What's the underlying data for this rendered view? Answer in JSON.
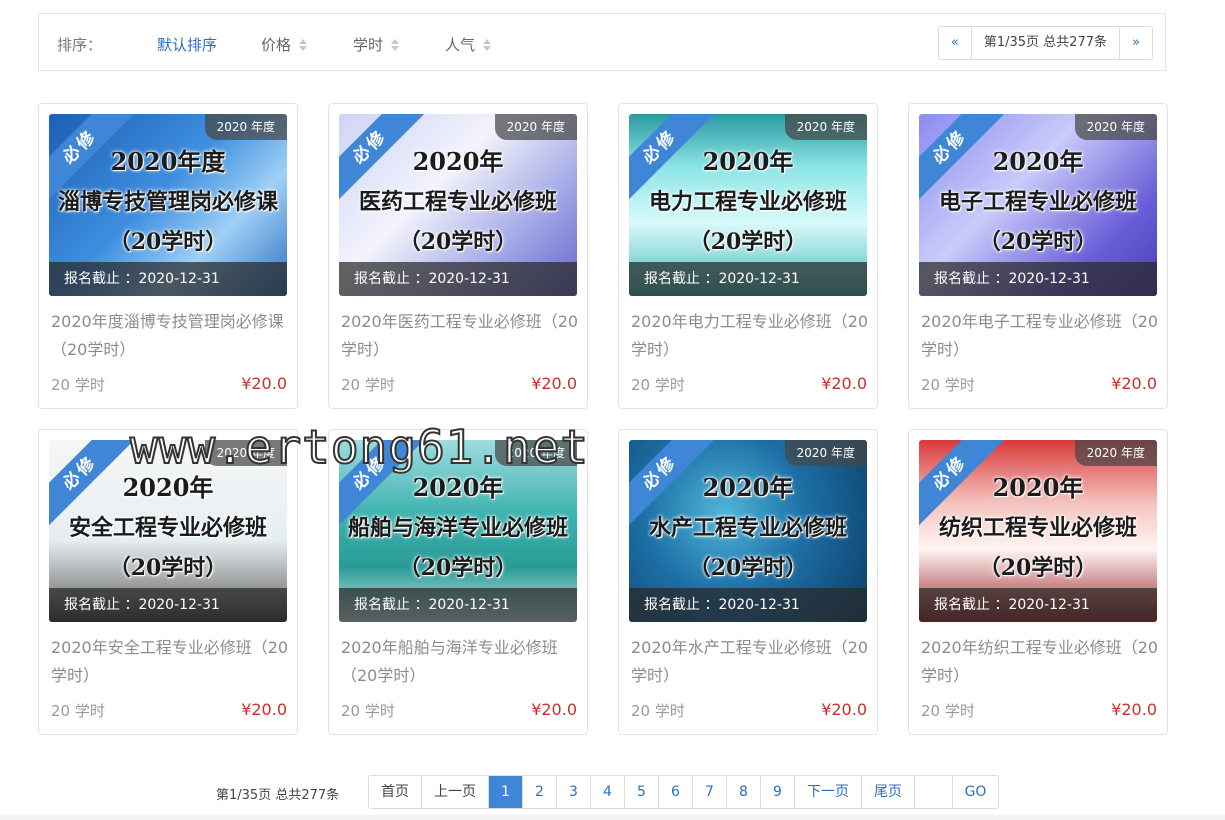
{
  "sort": {
    "label": "排序：",
    "options": [
      "默认排序",
      "价格",
      "学时",
      "人气"
    ]
  },
  "mini_pager": {
    "prev": "«",
    "info": "第1/35页 总共277条",
    "next": "»"
  },
  "ribbon_text": "必修",
  "year_badge": "2020 年度",
  "courses": [
    {
      "art": [
        "2020年度",
        "淄博专技管理岗必修课",
        "（20学时）"
      ],
      "deadline": "报名截止 ：2020-12-31",
      "name": "2020年度淄博专技管理岗必修课（20学时）",
      "hours": "20 学时",
      "price": "¥20.0",
      "bg": "linear-gradient(135deg,#1d5fb4 0%,#3f8fe0 45%,#9fd0f5 70%,#2e6fc0 100%)"
    },
    {
      "art": [
        "2020年",
        "医药工程专业必修班",
        "（20学时）"
      ],
      "deadline": "报名截止 ：2020-12-31",
      "name": "2020年医药工程专业必修班（20学时）",
      "hours": "20 学时",
      "price": "¥20.0",
      "bg": "linear-gradient(135deg,#cfd4f4 0%,#f2f3fc 40%,#9aa0e2 75%,#6a64c8 100%)"
    },
    {
      "art": [
        "2020年",
        "电力工程专业必修班",
        "（20学时）"
      ],
      "deadline": "报名截止 ：2020-12-31",
      "name": "2020年电力工程专业必修班（20学时）",
      "hours": "20 学时",
      "price": "¥20.0",
      "bg": "linear-gradient(180deg,#2a9aa3 0%,#8ee6e6 30%,#d8fafa 60%,#45b8b8 100%)"
    },
    {
      "art": [
        "2020年",
        "电子工程专业必修班",
        "（20学时）"
      ],
      "deadline": "报名截止 ：2020-12-31",
      "name": "2020年电子工程专业必修班（20学时）",
      "hours": "20 学时",
      "price": "¥20.0",
      "bg": "linear-gradient(135deg,#8a8cf0 0%,#c9cbfa 40%,#6a5fd8 75%,#4a3fb8 100%)"
    },
    {
      "art": [
        "2020年",
        "安全工程专业必修班",
        "（20学时）"
      ],
      "deadline": "报名截止 ：2020-12-31",
      "name": "2020年安全工程专业必修班（20学时）",
      "hours": "20 学时",
      "price": "¥20.0",
      "bg": "linear-gradient(180deg,#f6f6f6 0%,#e6eef2 55%,#8a8a8a 85%,#3a3a3a 100%)"
    },
    {
      "art": [
        "2020年",
        "船舶与海洋专业必修班",
        "（20学时）"
      ],
      "deadline": "报名截止 ：2020-12-31",
      "name": "2020年船舶与海洋专业必修班（20学时）",
      "hours": "20 学时",
      "price": "¥20.0",
      "bg": "linear-gradient(180deg,#9fdcde 0%,#3fb4b0 40%,#2a9a96 70%,#d6eef0 100%)"
    },
    {
      "art": [
        "2020年",
        "水产工程专业必修班",
        "（20学时）"
      ],
      "deadline": "报名截止 ：2020-12-31",
      "name": "2020年水产工程专业必修班（20学时）",
      "hours": "20 学时",
      "price": "¥20.0",
      "bg": "radial-gradient(circle at 40% 40%,#4fb6d8 0%,#1d6fa6 45%,#0c3c66 100%)"
    },
    {
      "art": [
        "2020年",
        "纺织工程专业必修班",
        "（20学时）"
      ],
      "deadline": "报名截止 ：2020-12-31",
      "name": "2020年纺织工程专业必修班（20学时）",
      "hours": "20 学时",
      "price": "¥20.0",
      "bg": "linear-gradient(180deg,#d83a3a 0%,#f4c4c0 35%,#fff4f2 60%,#9a1e24 100%)"
    }
  ],
  "watermark": "www.ertong61.net",
  "pager": {
    "info": "第1/35页 总共277条",
    "first": "首页",
    "prev": "上一页",
    "pages": [
      "1",
      "2",
      "3",
      "4",
      "5",
      "6",
      "7",
      "8",
      "9"
    ],
    "next": "下一页",
    "last": "尾页",
    "go": "GO"
  },
  "colors": {
    "accent": "#3f86d6",
    "price": "#c9302c",
    "link": "#2a70c2"
  }
}
